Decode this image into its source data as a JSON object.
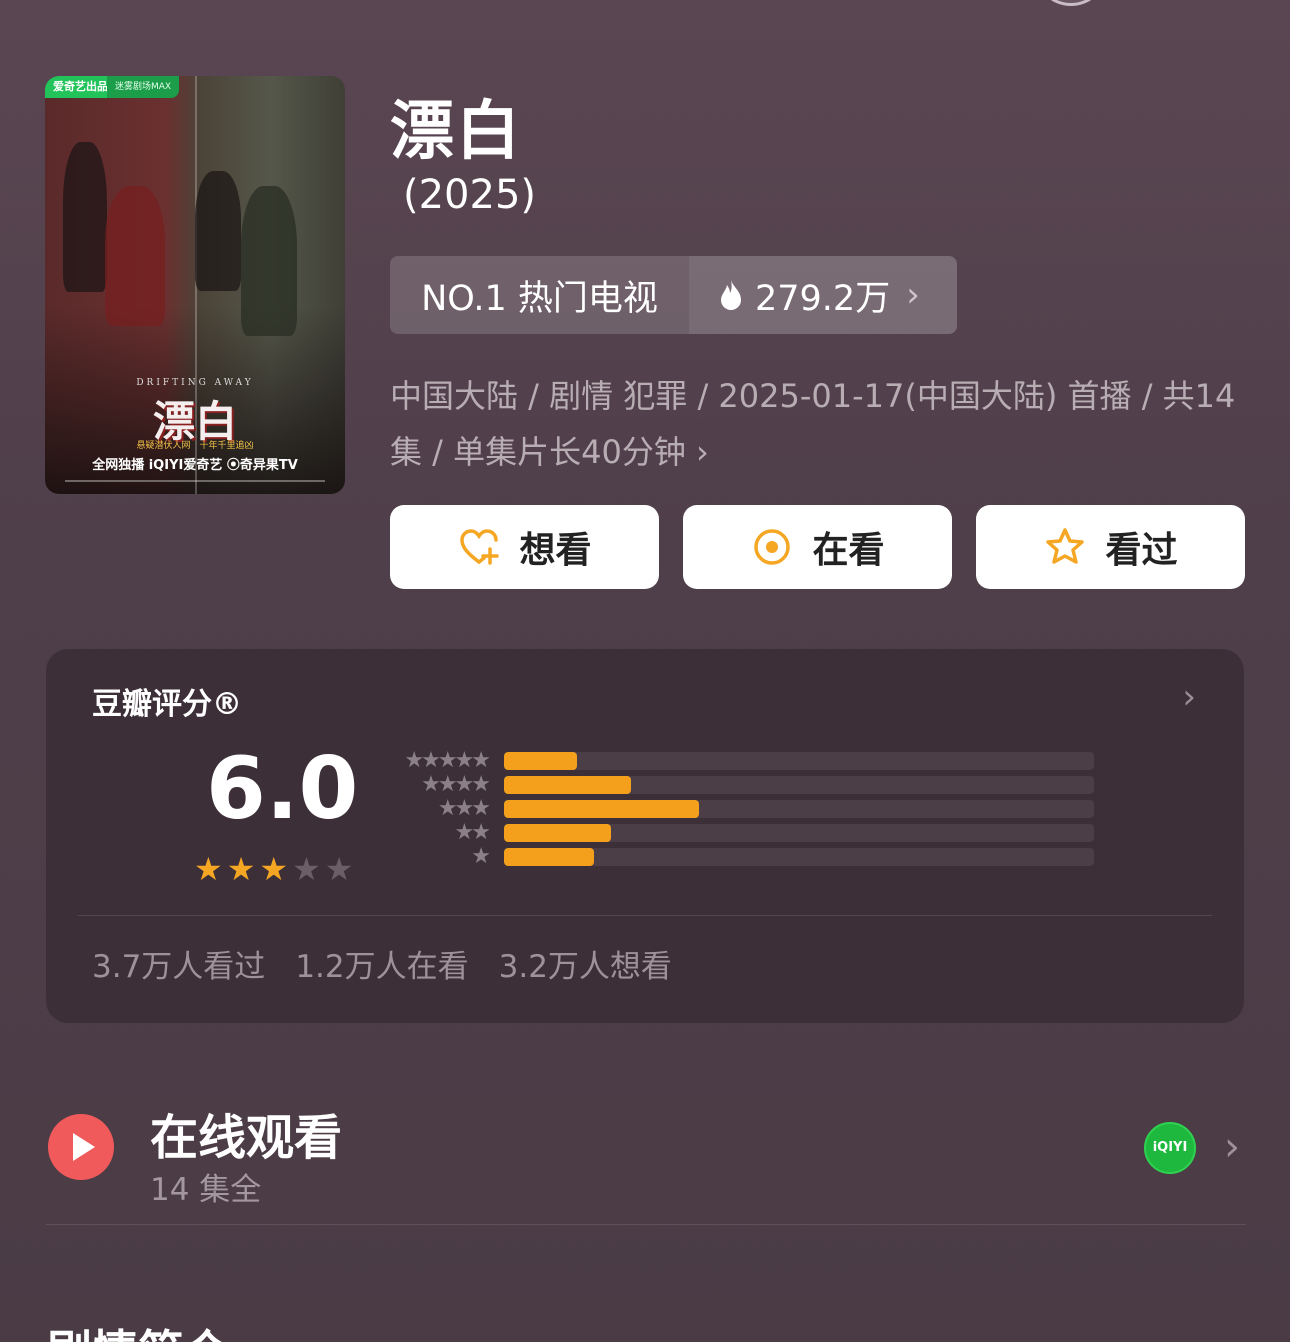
{
  "movie": {
    "title": "漂白",
    "year": "(2025)",
    "poster": {
      "badge": "爱奇艺出品",
      "badge2": "迷雾剧场MAX",
      "en_title": "DRIFTING AWAY",
      "big_title": "漂白",
      "tagline": "悬疑潜伏人网　十年千里追凶",
      "platforms": "全网独播 iQIYI爱奇艺 ⦿奇异果TV"
    },
    "rank": {
      "label": "NO.1 热门电视",
      "heat": "279.2万"
    },
    "meta": "中国大陆 / 剧情 犯罪 / 2025-01-17(中国大陆) 首播 / 共14集 / 单集片长40分钟",
    "meta_chev": "›"
  },
  "actions": [
    {
      "label": "想看",
      "icon": "heart-plus-icon"
    },
    {
      "label": "在看",
      "icon": "target-icon"
    },
    {
      "label": "看过",
      "icon": "star-outline-icon"
    }
  ],
  "rating": {
    "title": "豆瓣评分®",
    "arrow": "›",
    "score": "6.0",
    "stars_filled": 3,
    "stars_total": 5,
    "distribution": [
      {
        "stars": "★★★★★",
        "percent": 12.4
      },
      {
        "stars": "★★★★",
        "percent": 21.5
      },
      {
        "stars": "★★★",
        "percent": 33.0
      },
      {
        "stars": "★★",
        "percent": 18.2
      },
      {
        "stars": "★",
        "percent": 15.2
      }
    ],
    "stats": {
      "watched": "3.7万人看过",
      "watching": "1.2万人在看",
      "want": "3.2万人想看"
    }
  },
  "watch": {
    "title": "在线观看",
    "subtitle": "14 集全",
    "platform_logo_text": "iQIYI",
    "arrow": "›"
  },
  "next_section": {
    "title": "剧情简介"
  },
  "colors": {
    "background": "#4f3f4a",
    "card": "#3d2f38",
    "accent": "#f5a01c",
    "play": "#f05a5a",
    "iqiyi": "#1fb83e"
  }
}
